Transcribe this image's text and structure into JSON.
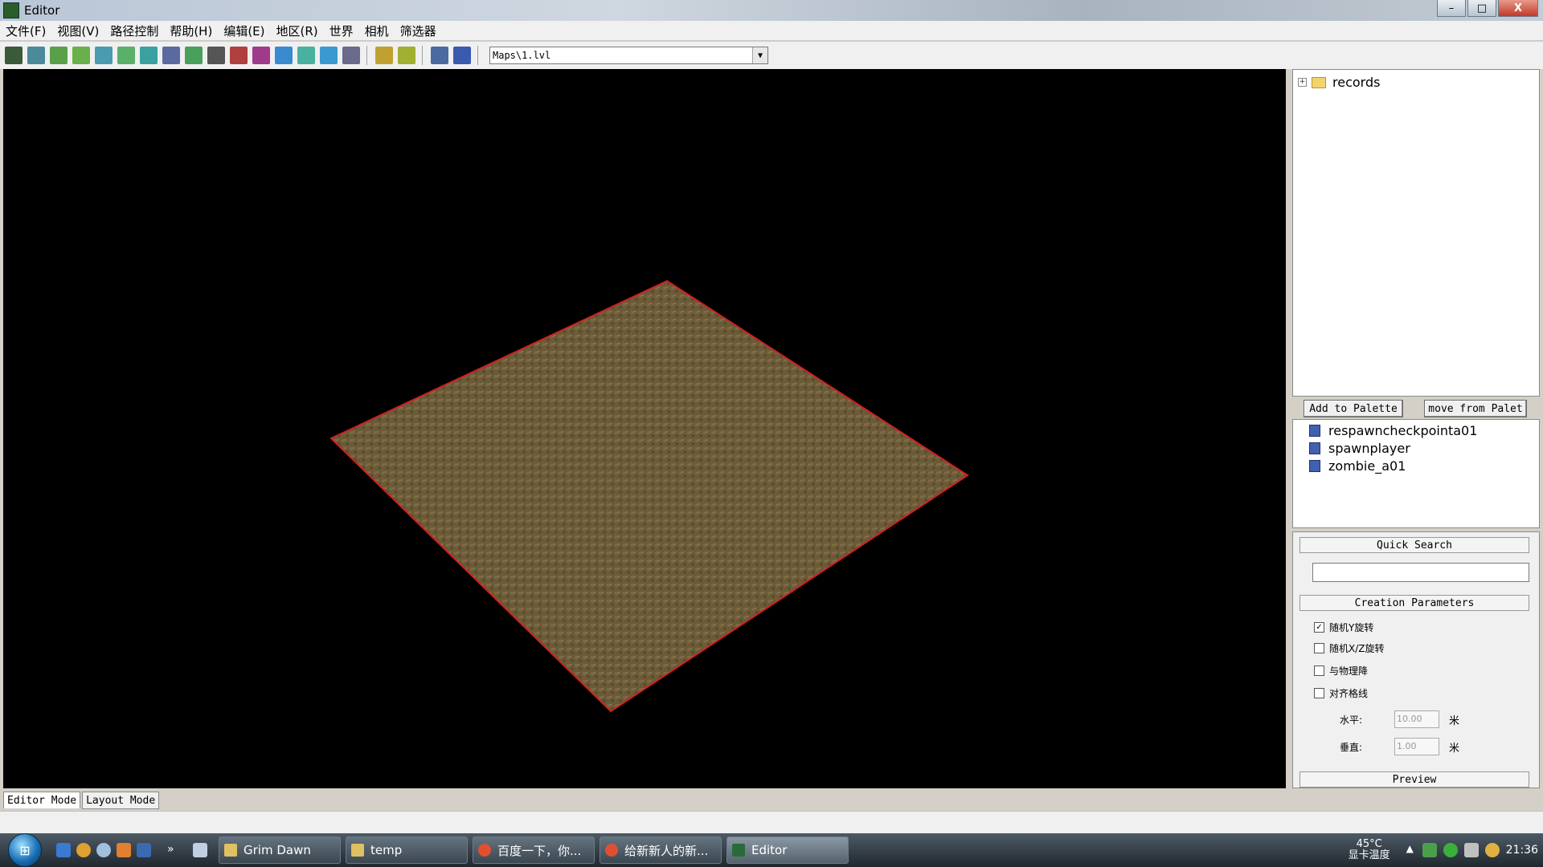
{
  "window": {
    "title": "Editor",
    "min": "–",
    "max": "□",
    "close": "X"
  },
  "menu": [
    "文件(F)",
    "视图(V)",
    "路径控制",
    "帮助(H)",
    "编辑(E)",
    "地区(R)",
    "世界",
    "相机",
    "筛选器"
  ],
  "toolbar": {
    "icons": [
      {
        "name": "terrain-icon",
        "color": "#3a5a3a"
      },
      {
        "name": "grid-icon",
        "color": "#4a8a9a"
      },
      {
        "name": "raise-icon",
        "color": "#5aa04a"
      },
      {
        "name": "lower-icon",
        "color": "#6ab04a"
      },
      {
        "name": "smooth-icon",
        "color": "#4a9ab0"
      },
      {
        "name": "paint-icon",
        "color": "#5ab06a"
      },
      {
        "name": "water-icon",
        "color": "#3aa0a0"
      },
      {
        "name": "layout-icon",
        "color": "#5a6aa0"
      },
      {
        "name": "path-icon",
        "color": "#4aa05a"
      },
      {
        "name": "object-icon",
        "color": "#555555"
      },
      {
        "name": "entity-icon",
        "color": "#b04040"
      },
      {
        "name": "region-icon",
        "color": "#a03a8a"
      },
      {
        "name": "level-icon",
        "color": "#3a8ad0"
      },
      {
        "name": "slope-icon",
        "color": "#4ab0a0"
      },
      {
        "name": "sky-icon",
        "color": "#3a9ad0"
      },
      {
        "name": "filter-icon",
        "color": "#6a6a8a"
      }
    ],
    "history_icons": [
      {
        "name": "undo-icon",
        "color": "#c0a030"
      },
      {
        "name": "redo-icon",
        "color": "#a0b030"
      }
    ],
    "view_icons": [
      {
        "name": "zoom-icon",
        "color": "#4a6aa0"
      },
      {
        "name": "camera-icon",
        "color": "#3a5ab0"
      }
    ],
    "map_path": "Maps\\1.lvl"
  },
  "tree": {
    "root": "records",
    "expander": "+"
  },
  "palette_buttons": {
    "add": "Add to Palette",
    "remove": "move from Palet"
  },
  "palette_items": [
    "respawncheckpointa01",
    "spawnplayer",
    "zombie_a01"
  ],
  "quick_search": {
    "label": "Quick Search",
    "value": ""
  },
  "creation": {
    "label": "Creation Parameters",
    "options": [
      {
        "label": "随机Y旋转",
        "checked": true
      },
      {
        "label": "随机X/Z旋转",
        "checked": false
      },
      {
        "label": "与物理降",
        "checked": false
      },
      {
        "label": "对齐格线",
        "checked": false
      }
    ],
    "horizontal": {
      "label": "水平:",
      "value": "10.00",
      "unit": "米"
    },
    "vertical": {
      "label": "垂直:",
      "value": "1.00",
      "unit": "米"
    },
    "preview": "Preview"
  },
  "modes": [
    "Editor Mode",
    "Layout Mode"
  ],
  "taskbar": {
    "tasks": [
      {
        "label": "Grim Dawn",
        "color": "#e0c060"
      },
      {
        "label": "temp",
        "color": "#e0c060"
      },
      {
        "label": "百度一下，你...",
        "color": "#e05030"
      },
      {
        "label": "给新新人的新...",
        "color": "#e05030"
      },
      {
        "label": "Editor",
        "color": "#2a6a3a"
      }
    ],
    "temperature": "45°C",
    "temp_label": "显卡温度",
    "clock": "21:36"
  },
  "colors": {
    "terrain": "#6b5a37",
    "terrain_edge": "#d02020",
    "viewport_bg": "#000000"
  }
}
